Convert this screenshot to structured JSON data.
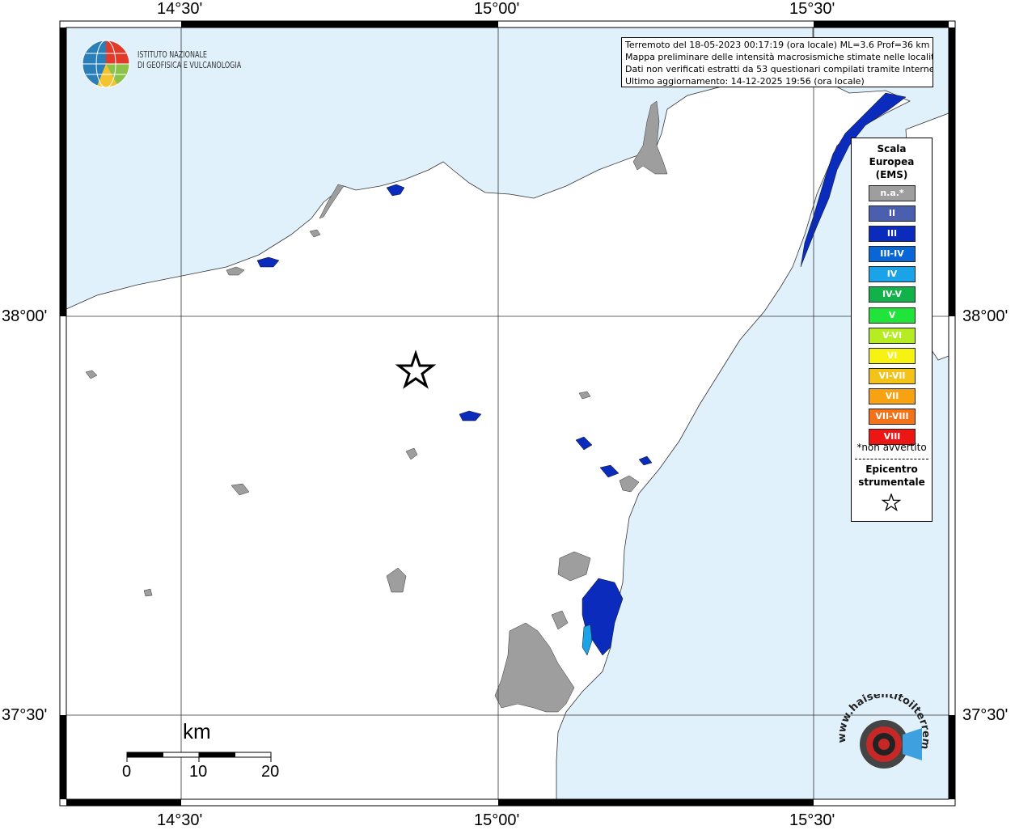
{
  "map": {
    "ticks_longitude": [
      "14°30'",
      "15°00'",
      "15°30'"
    ],
    "ticks_latitude": [
      "38°00'",
      "37°30'"
    ],
    "sea_color": "#e0f1fc",
    "land_color": "#ffffff"
  },
  "logo": {
    "line1": "ISTITUTO NAZIONALE",
    "line2": "DI GEOFISICA E VULCANOLOGIA"
  },
  "info": {
    "line1": "Terremoto del 18-05-2023 00:17:19 (ora locale) ML=3.6 Prof=36 km",
    "line2": "Mappa preliminare delle intensità macrosismiche stimate nelle località",
    "line3": "Dati non verificati estratti da 53 questionari compilati tramite Internet.",
    "line4": "Ultimo aggiornamento: 14-12-2025 19:56 (ora locale)"
  },
  "legend": {
    "title1": "Scala",
    "title2": "Europea",
    "title3": "(EMS)",
    "items": [
      {
        "label": "n.a.*",
        "color": "#9e9e9e"
      },
      {
        "label": "II",
        "color": "#4a5fae"
      },
      {
        "label": "III",
        "color": "#0b2bbd"
      },
      {
        "label": "III-IV",
        "color": "#0866d6"
      },
      {
        "label": "IV",
        "color": "#1aa3e8"
      },
      {
        "label": "IV-V",
        "color": "#12b24a"
      },
      {
        "label": "V",
        "color": "#21e43a"
      },
      {
        "label": "V-VI",
        "color": "#b5ec22"
      },
      {
        "label": "VI",
        "color": "#f8f213"
      },
      {
        "label": "VI-VII",
        "color": "#f4c31a"
      },
      {
        "label": "VII",
        "color": "#f7a210"
      },
      {
        "label": "VII-VIII",
        "color": "#f47318"
      },
      {
        "label": "VIII",
        "color": "#ee1515"
      }
    ],
    "note": "*non avvertito",
    "epicenter1": "Epicentro",
    "epicenter2": "strumentale"
  },
  "scale_bar": {
    "unit": "km",
    "labels": [
      "0",
      "10",
      "20"
    ]
  },
  "brand": {
    "text": "www.haisentitoilterremoto.it"
  }
}
